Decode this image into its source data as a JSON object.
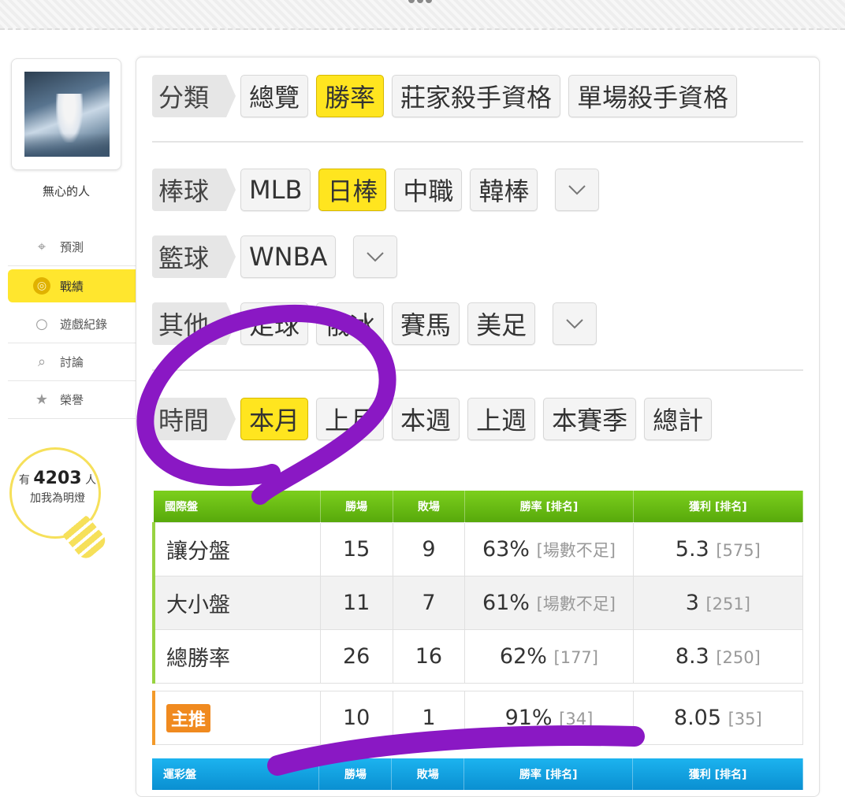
{
  "user": {
    "name": "無心的人"
  },
  "sidebar": {
    "items": [
      {
        "label": "預測",
        "icon": "crosshair-icon"
      },
      {
        "label": "戰績",
        "icon": "target-icon",
        "active": true
      },
      {
        "label": "遊戲紀錄",
        "icon": "circle-icon"
      },
      {
        "label": "討論",
        "icon": "chat-icon"
      },
      {
        "label": "榮譽",
        "icon": "star-icon"
      }
    ],
    "fans": {
      "prefix": "有",
      "count": "4203",
      "suffix": "人",
      "line2": "加我為明燈"
    }
  },
  "filters": {
    "category": {
      "label": "分類",
      "options": [
        "總覽",
        "勝率",
        "莊家殺手資格",
        "單場殺手資格"
      ],
      "selected": "勝率"
    },
    "baseball": {
      "label": "棒球",
      "options": [
        "MLB",
        "日棒",
        "中職",
        "韓棒"
      ],
      "selected": "日棒"
    },
    "basketball": {
      "label": "籃球",
      "options": [
        "WNBA"
      ]
    },
    "other": {
      "label": "其他",
      "options": [
        "足球",
        "俄冰",
        "賽馬",
        "美足"
      ]
    },
    "time": {
      "label": "時間",
      "options": [
        "本月",
        "上月",
        "本週",
        "上週",
        "本賽季",
        "總計"
      ],
      "selected": "本月"
    }
  },
  "intl_table": {
    "headers": [
      "國際盤",
      "勝場",
      "敗場",
      "勝率 [排名]",
      "獲利 [排名]"
    ],
    "rows": [
      {
        "name": "讓分盤",
        "wins": "15",
        "losses": "9",
        "rate": "63%",
        "rate_rank": "[場數不足]",
        "profit": "5.3",
        "profit_rank": "[575]"
      },
      {
        "name": "大小盤",
        "wins": "11",
        "losses": "7",
        "rate": "61%",
        "rate_rank": "[場數不足]",
        "profit": "3",
        "profit_rank": "[251]"
      },
      {
        "name": "總勝率",
        "wins": "26",
        "losses": "16",
        "rate": "62%",
        "rate_rank": "[177]",
        "profit": "8.3",
        "profit_rank": "[250]"
      }
    ],
    "main_pick": {
      "label": "主推",
      "wins": "10",
      "losses": "1",
      "rate": "91%",
      "rate_rank": "[34]",
      "profit": "8.05",
      "profit_rank": "[35]"
    }
  },
  "sports_table": {
    "headers": [
      "運彩盤",
      "勝場",
      "敗場",
      "勝率 [排名]",
      "獲利 [排名]"
    ]
  },
  "colors": {
    "accent_yellow": "#ffe51f",
    "header_green": "#5fb30f",
    "header_blue": "#0f97d8",
    "annotation_purple": "#8a18c4",
    "main_pick_orange": "#f08a1f"
  }
}
